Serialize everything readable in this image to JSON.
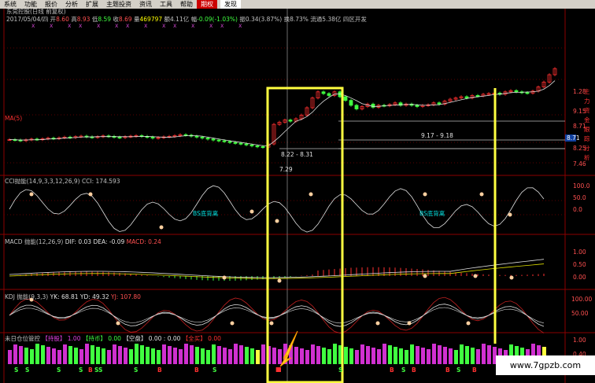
{
  "menu": [
    {
      "label": "系统",
      "active": false
    },
    {
      "label": "功能",
      "active": false
    },
    {
      "label": "报价",
      "active": false
    },
    {
      "label": "分析",
      "active": false
    },
    {
      "label": "扩展",
      "active": false
    },
    {
      "label": "主题投资",
      "active": false
    },
    {
      "label": "资讯",
      "active": false
    },
    {
      "label": "工具",
      "active": false
    },
    {
      "label": "帮助",
      "active": false
    },
    {
      "label": "期权",
      "active": true
    },
    {
      "label": "发现",
      "active": false,
      "find": true
    }
  ],
  "header": {
    "stock_title": "东莞控股(日线 前复权)",
    "date": "2017/05/04/四",
    "open_label": "开",
    "open": "8.60",
    "high_label": "高",
    "high": "8.93",
    "low_label": "低",
    "low": "8.59",
    "close_label": "收",
    "close": "8.69",
    "volume_label": "量",
    "volume": "469797",
    "amount_label": "额",
    "amount": "4.11亿",
    "change_label": "幅",
    "change": "-0.09(-1.03%)",
    "amplitude_label": "振",
    "amplitude": "0.34(3.87%)",
    "turnover_label": "换",
    "turnover": "8.73%",
    "float_label": "流通",
    "float": "5.38亿",
    "extra": "四区开发"
  },
  "main_chart": {
    "ma_label": "MA(5)",
    "price_range_1": "9.17 - 9.18",
    "price_range_2": "8.22 - 8.31",
    "low_price": "7.29",
    "right_axis": [
      "1.28",
      "9.15",
      "8.71",
      "8.25",
      "7.46"
    ],
    "right_labels": [
      "主",
      "力",
      "资",
      "金",
      "跟",
      "踪",
      "分",
      "析"
    ]
  },
  "cci": {
    "title": "CCI抛能(14,9,3,3,12,26,9) CCI: 174.593",
    "annotation_1": "BS底背离",
    "annotation_2": "BS底背离",
    "right_axis": [
      "100.0",
      "50.0",
      "0.0"
    ]
  },
  "macd": {
    "title_prefix": "MACD 抛能(12,26,9)",
    "dif": "DIF: 0.03",
    "dea": "DEA: -0.09",
    "macd_value": "MACD: 0.24",
    "right_axis": [
      "1.00",
      "0.50",
      "0.00"
    ]
  },
  "kdj": {
    "title_prefix": "KDJ 抛能(9,3,3)",
    "yk": "YK: 68.81",
    "yd": "YD: 49.32",
    "yj": "YJ: 107.80",
    "right_axis": [
      "100.00",
      "50.00"
    ]
  },
  "position": {
    "title": "未日仓位管控",
    "hold_label": "【持股】",
    "hold_value": "1.00",
    "cash_label": "【持币】",
    "cash_value": "0.00",
    "empty_label": "【空盘】",
    "empty_value": "0.00",
    "extra_value": "0.00",
    "full_label": "【全买】",
    "full_value": "0.00",
    "right_axis": [
      "1.00",
      "0.40"
    ]
  },
  "signals": {
    "s_label": "S",
    "b_label": "B"
  },
  "watermark": "www.7gpzb.com",
  "chart_data": {
    "type": "candlestick",
    "close": [
      7.6,
      7.58,
      7.56,
      7.59,
      7.62,
      7.6,
      7.63,
      7.66,
      7.64,
      7.67,
      7.7,
      7.68,
      7.72,
      7.74,
      7.71,
      7.69,
      7.72,
      7.75,
      7.73,
      7.7,
      7.68,
      7.72,
      7.74,
      7.76,
      7.73,
      7.7,
      7.66,
      7.68,
      7.71,
      7.73,
      7.76,
      7.8,
      7.78,
      7.74,
      7.7,
      7.66,
      7.62,
      7.58,
      7.55,
      7.52,
      7.48,
      7.45,
      7.42,
      7.38,
      7.34,
      7.31,
      7.29,
      7.42,
      8.22,
      8.31,
      8.4,
      8.35,
      8.45,
      8.6,
      8.9,
      9.3,
      9.55,
      9.48,
      9.4,
      9.55,
      9.35,
      9.2,
      9.0,
      8.85,
      8.95,
      9.05,
      8.92,
      9.0,
      8.98,
      9.03,
      9.1,
      9.0,
      9.05,
      9.0,
      8.95,
      9.0,
      9.02,
      9.1,
      9.05,
      9.17,
      9.25,
      9.3,
      9.35,
      9.3,
      9.4,
      9.38,
      9.45,
      9.48,
      9.5,
      9.45,
      9.55,
      9.6,
      9.55,
      9.52,
      9.5,
      9.58,
      9.75,
      9.95,
      10.25,
      10.5
    ]
  }
}
